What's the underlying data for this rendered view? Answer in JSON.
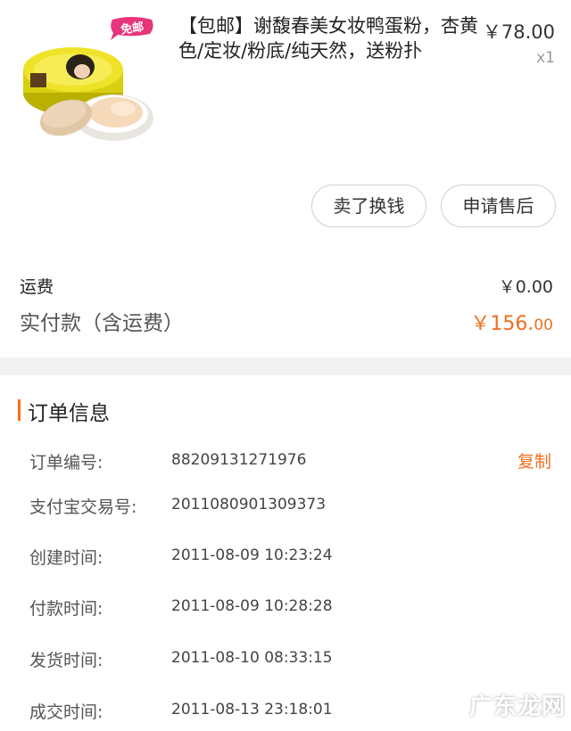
{
  "product": {
    "badge": "免邮",
    "title": "【包邮】谢馥春美女妆鸭蛋粉，杏黄色/定妆/粉底/纯天然，送粉扑",
    "price": "￥78.00",
    "quantity": "x1"
  },
  "actions": {
    "sell_label": "卖了换钱",
    "after_sale_label": "申请售后"
  },
  "fees": {
    "shipping_label": "运费",
    "shipping_value": "￥0.00",
    "paid_label": "实付款（含运费）",
    "paid_value_main": "￥156.",
    "paid_value_cents": "00"
  },
  "order_info": {
    "title": "订单信息",
    "copy_label": "复制",
    "rows": [
      {
        "label": "订单编号:",
        "value": "88209131271976"
      },
      {
        "label": "支付宝交易号:",
        "value": "2011080901309373"
      },
      {
        "label": "创建时间:",
        "value": "2011-08-09 10:23:24"
      },
      {
        "label": "付款时间:",
        "value": "2011-08-09 10:28:28"
      },
      {
        "label": "发货时间:",
        "value": "2011-08-10 08:33:15"
      },
      {
        "label": "成交时间:",
        "value": "2011-08-13 23:18:01"
      }
    ]
  },
  "watermark": "广东龙网",
  "colors": {
    "accent": "#f07020",
    "badge": "#e8347a",
    "divider": "#f2f2f2"
  }
}
